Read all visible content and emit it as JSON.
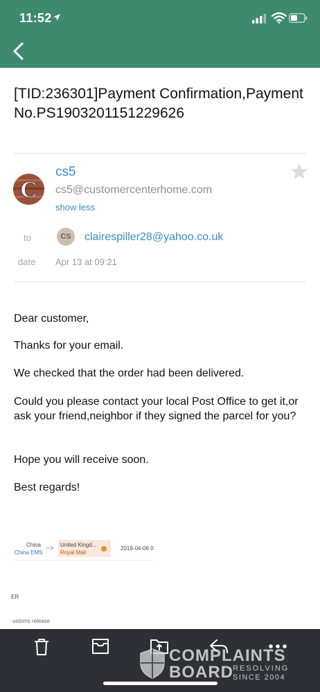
{
  "status_bar": {
    "time": "11:52"
  },
  "email": {
    "subject": "[TID:236301]Payment Confirmation,Payment No.PS1903201151229626",
    "sender": {
      "name": "cs5",
      "email": "cs5@customercenterhome.com",
      "avatar_initial": "C",
      "show_less": "show less"
    },
    "to_label": "to",
    "recipient": {
      "avatar_text": "CS",
      "email": "clairespiller28@yahoo.co.uk"
    },
    "date_label": "date",
    "date_value": "Apr 13 at 09:21",
    "body": [
      "Dear customer,",
      "Thanks for your email.",
      "We checked that the order had been delivered.",
      "Could you please contact your local Post Office to get it,or ask your friend,neighbor if they signed  the parcel for you?",
      "Hope you will receive soon.",
      "Best regards!"
    ],
    "tracking": {
      "origin_country": "China",
      "origin_carrier": "China EMS",
      "dest_country": "United Kingd...",
      "dest_carrier": "Royal Mail",
      "date": "2019-04-06 0"
    },
    "fragments": {
      "header": "ER",
      "customs": "ustoms release"
    }
  },
  "toolbar": {
    "icons": [
      "trash-icon",
      "archive-icon",
      "move-folder-icon",
      "reply-icon",
      "more-icon"
    ]
  },
  "watermark": {
    "line1": "COMPLAINTS",
    "line2": "BOARD",
    "tag1": "RESOLVING",
    "tag2": "SINCE 2004"
  },
  "colors": {
    "header_green": "#3d8a6d",
    "link_blue": "#3a8cc2",
    "toolbar_dark": "#2e3036",
    "muted_gray": "#a5a5a5"
  }
}
